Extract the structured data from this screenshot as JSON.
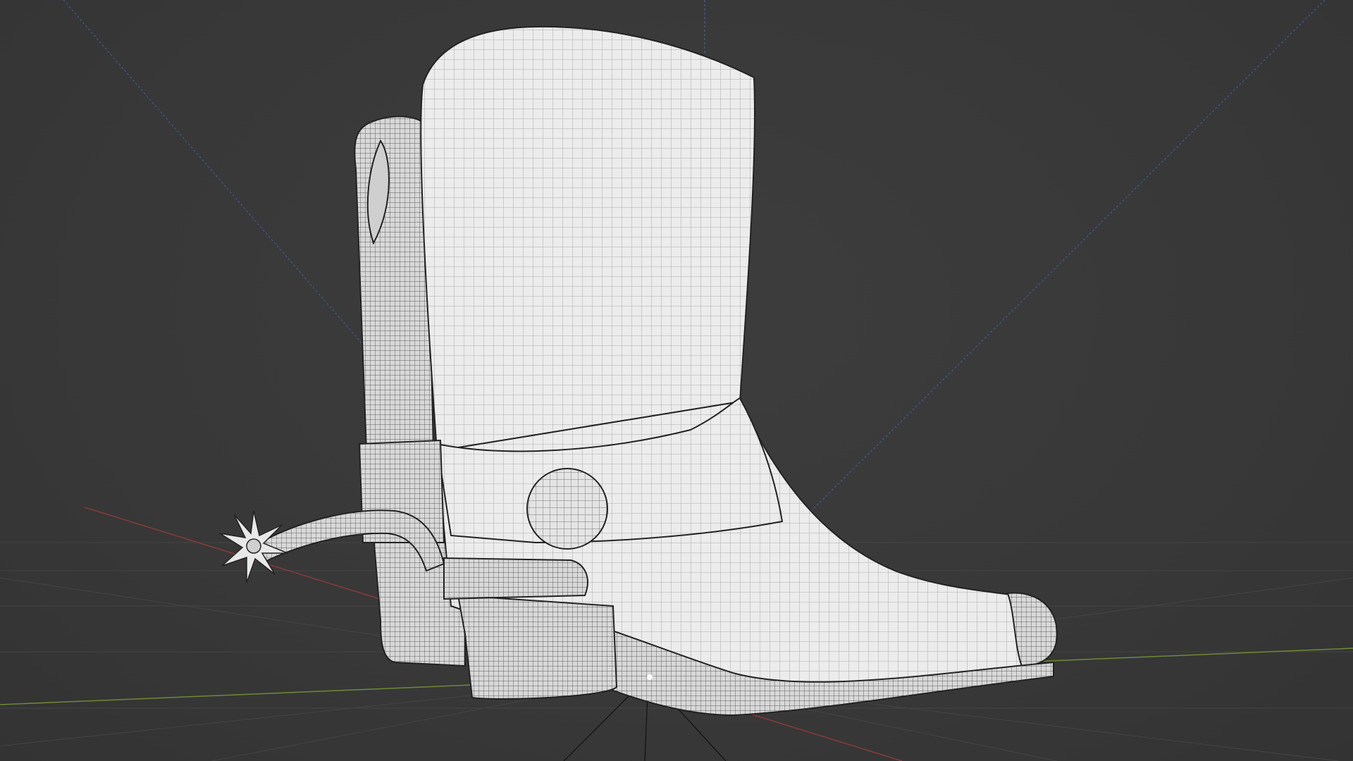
{
  "app": {
    "name": "3D viewport"
  },
  "viewport": {
    "background": "#3a3a3a",
    "grid_color": "#4a4a4a",
    "axis_x_color": "#8a3a3a",
    "axis_y_color": "#6e8a35",
    "axis_z_color": "#3a5a9a",
    "mesh_fill": "#e8e8e8",
    "mesh_wire": "#2a2a2a"
  },
  "scene": {
    "object": "cowboy-boot-mesh",
    "parts": [
      "boot-shaft",
      "boot-back-shaft",
      "ankle-strap",
      "strap-button",
      "spur",
      "spur-rowel",
      "heel",
      "sole",
      "toe-cap",
      "foot"
    ],
    "origin_icon": "origin-point-icon"
  }
}
